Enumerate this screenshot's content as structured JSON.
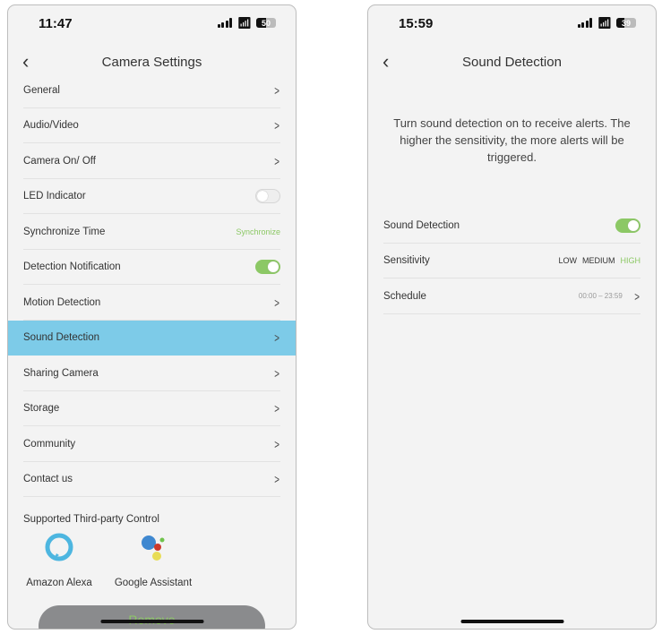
{
  "left": {
    "status": {
      "time": "11:47",
      "battery": "50"
    },
    "title": "Camera Settings",
    "items": [
      {
        "label": "General",
        "control": "chevron"
      },
      {
        "label": "Audio/Video",
        "control": "chevron"
      },
      {
        "label": "Camera On/ Off",
        "control": "chevron"
      },
      {
        "label": "LED Indicator",
        "control": "toggle",
        "on": false
      },
      {
        "label": "Synchronize Time",
        "control": "link",
        "value": "Synchronize"
      },
      {
        "label": "Detection Notification",
        "control": "toggle",
        "on": true
      },
      {
        "label": "Motion Detection",
        "control": "chevron"
      },
      {
        "label": "Sound Detection",
        "control": "chevron",
        "highlighted": true
      },
      {
        "label": "Sharing Camera",
        "control": "chevron"
      },
      {
        "label": "Storage",
        "control": "chevron"
      },
      {
        "label": "Community",
        "control": "chevron"
      },
      {
        "label": "Contact us",
        "control": "chevron"
      }
    ],
    "third_party_heading": "Supported Third-party Control",
    "alexa": "Amazon Alexa",
    "google": "Google Assistant",
    "remove": "Remove"
  },
  "right": {
    "status": {
      "time": "15:59",
      "battery": "39"
    },
    "title": "Sound Detection",
    "description": "Turn sound detection on to receive alerts. The higher the sensitivity, the more alerts will be triggered.",
    "sound_detection_label": "Sound Detection",
    "sound_detection_on": true,
    "sensitivity_label": "Sensitivity",
    "sensitivity_options": [
      "LOW",
      "MEDIUM",
      "HIGH"
    ],
    "sensitivity_selected": "HIGH",
    "schedule_label": "Schedule",
    "schedule_value": "00:00 – 23:59"
  },
  "colors": {
    "accent": "#8cc865",
    "highlight": "#7dcbe8"
  }
}
